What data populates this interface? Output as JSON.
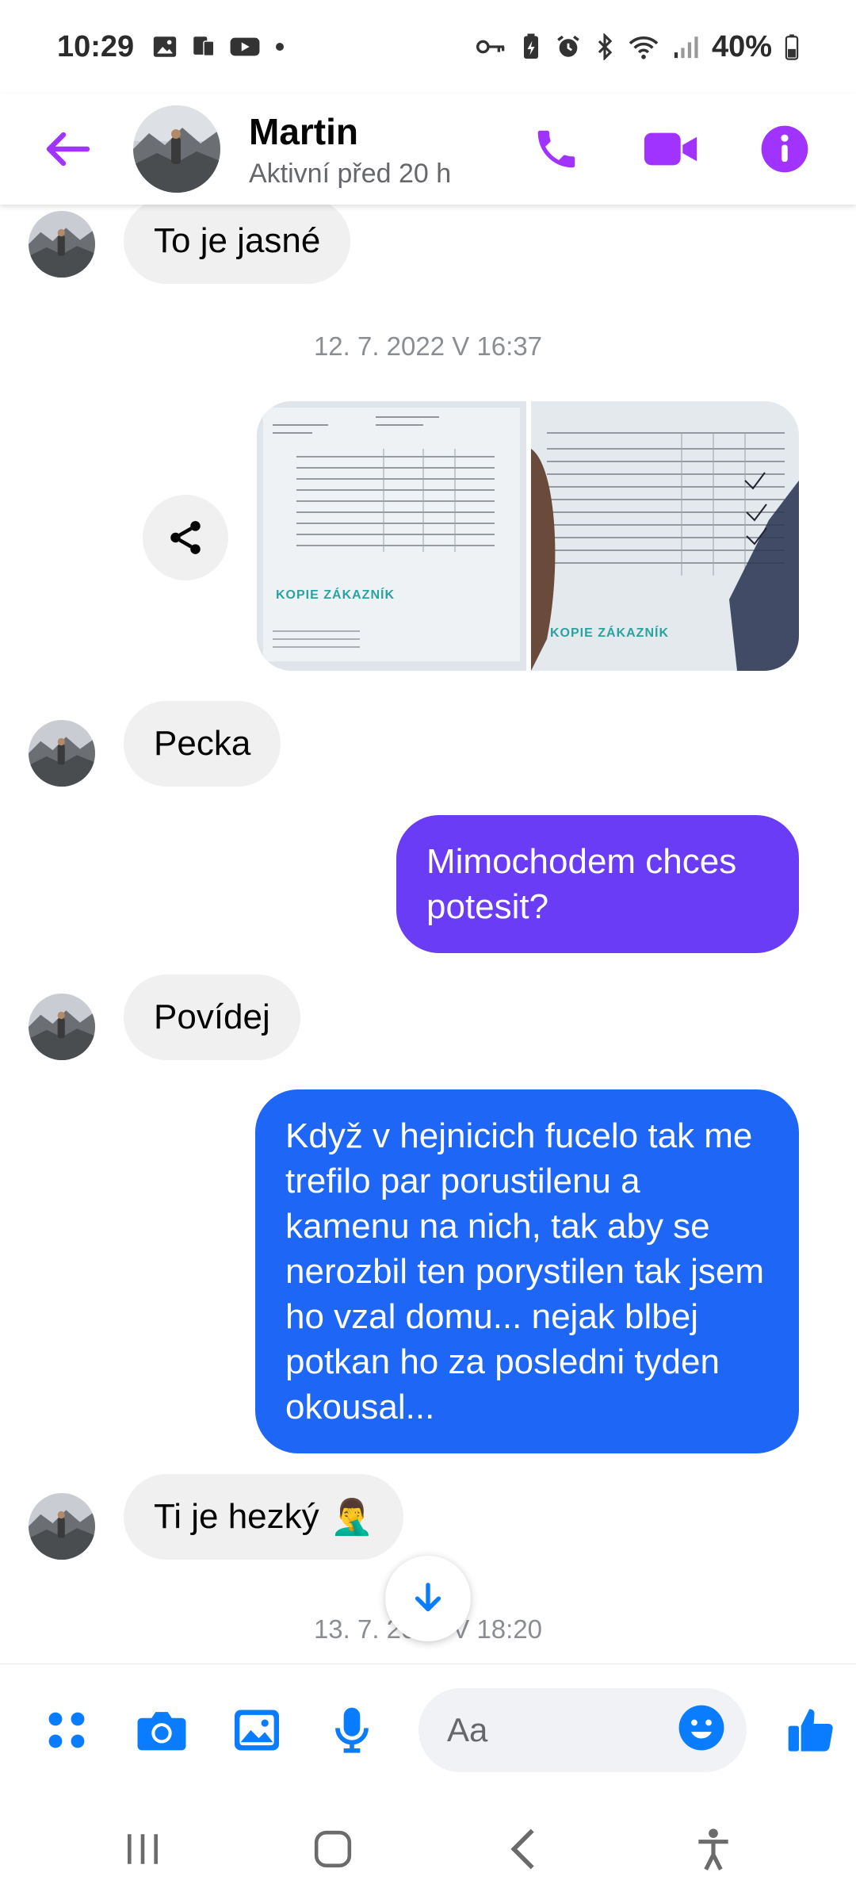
{
  "status_bar": {
    "time": "10:29",
    "battery": "40%"
  },
  "header": {
    "name": "Martin",
    "status": "Aktivní před 20 h",
    "accent_color": "#a033ff"
  },
  "messages": {
    "m1": "To je jasné",
    "ts1": "12. 7. 2022 V 16:37",
    "photo_caption_left": "KOPIE ZÁKAZNÍK",
    "photo_caption_right": "KOPIE ZÁKAZNÍK",
    "m2": "Pecka",
    "m3": "Mimochodem chces potesit?",
    "m4": "Povídej",
    "m5": "Když v hejnicich fucelo tak me trefilo par porustilenu a kamenu na nich, tak aby se nerozbil ten porystilen tak jsem ho vzal domu... nejak blbej potkan ho za posledni tyden okousal...",
    "m6": "Ti je hezký",
    "m6_emoji": "🤦‍♂️",
    "ts2": "13. 7. 2022 V 18:20"
  },
  "composer": {
    "placeholder": "Aa"
  },
  "icons": {
    "back": "arrow-left-icon",
    "call": "phone-icon",
    "video": "video-camera-icon",
    "info": "info-icon",
    "share": "share-icon",
    "apps": "apps-grid-icon",
    "camera": "camera-icon",
    "gallery": "image-icon",
    "mic": "microphone-icon",
    "emoji": "smiley-icon",
    "like": "thumbs-up-icon",
    "scroll": "arrow-down-icon"
  },
  "colors": {
    "outgoing_purple": "#6a3cf5",
    "outgoing_blue": "#1e66f5",
    "incoming_bg": "#f0f0f0",
    "composer_icon": "#0a7cff"
  }
}
